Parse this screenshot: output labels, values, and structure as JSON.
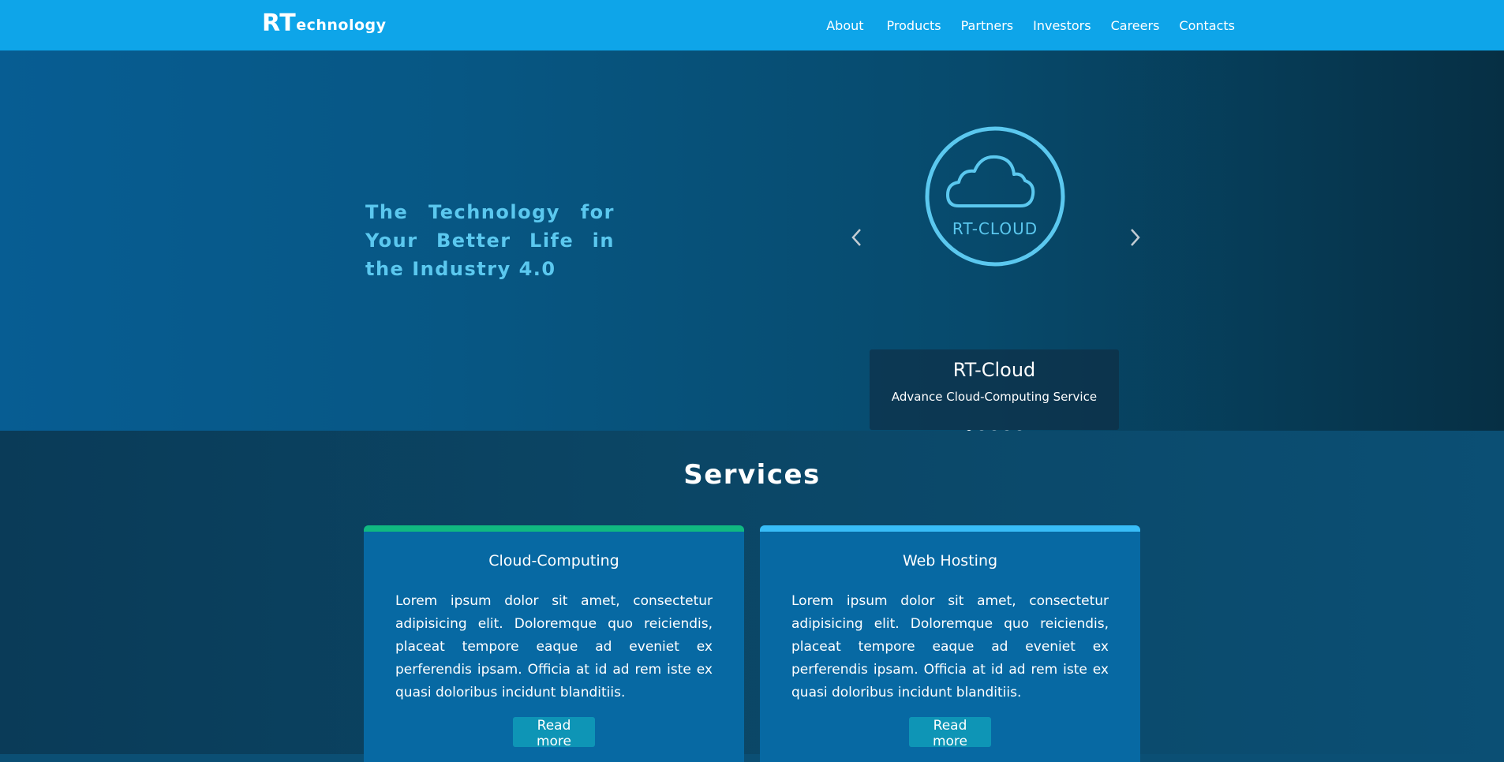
{
  "colors": {
    "navbar": "#0ea5e9",
    "hero_title": "#5bc8ef",
    "card_bg": "#0769a3",
    "card1_accent": "#10b981",
    "card2_accent": "#38bdf8",
    "button": "#0e95b6"
  },
  "nav": {
    "brand_big": "RT",
    "brand_small": "echnology",
    "links": [
      "About",
      "Products",
      "Partners",
      "Investors",
      "Careers",
      "Contacts"
    ]
  },
  "hero": {
    "title": "The Technology for Your Better Life in the Industry 4.0",
    "carousel": {
      "logo_text": "RT-CLOUD",
      "logo_icon": "cloud-icon",
      "caption_title": "RT-Cloud",
      "caption_sub": "Advance Cloud-Computing Service",
      "prev_icon": "chevron-left-icon",
      "next_icon": "chevron-right-icon",
      "slide_count": 5,
      "active_index": 0
    }
  },
  "services": {
    "title": "Services",
    "cards": [
      {
        "title": "Cloud-Computing",
        "text": "Lorem ipsum dolor sit amet, consectetur adipisicing elit. Doloremque quo reiciendis, placeat tempore eaque ad eveniet ex perferendis ipsam. Officia at id ad rem iste ex quasi doloribus incidunt blanditiis.",
        "button": "Read more"
      },
      {
        "title": "Web Hosting",
        "text": "Lorem ipsum dolor sit amet, consectetur adipisicing elit. Doloremque quo reiciendis, placeat tempore eaque ad eveniet ex perferendis ipsam. Officia at id ad rem iste ex quasi doloribus incidunt blanditiis.",
        "button": "Read more"
      }
    ]
  }
}
